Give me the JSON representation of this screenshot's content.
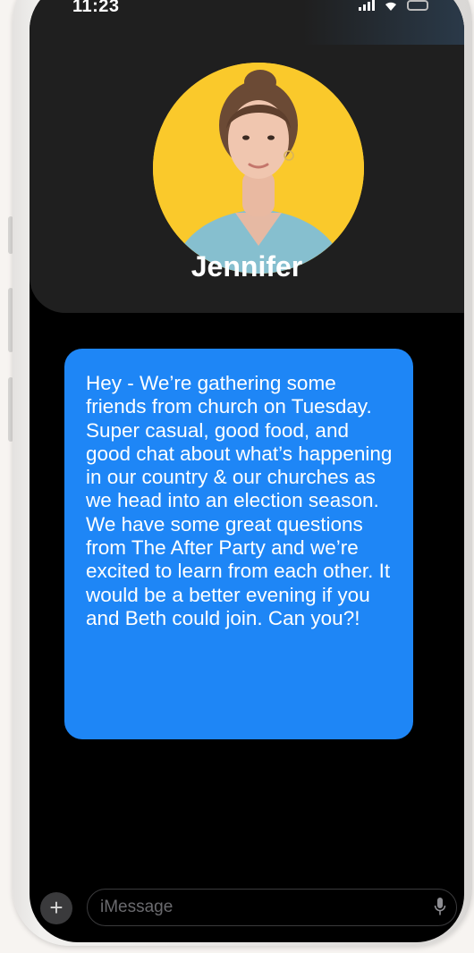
{
  "status_bar": {
    "time": "11:23"
  },
  "contact": {
    "name": "Jennifer",
    "avatar_bg": "#fac92b"
  },
  "message": {
    "text": "Hey - We’re gathering some friends from church on Tuesday. Super casual, good food, and good chat about what’s happening in our country & our churches as we head into an election season. We have some great questions from The After Party and we’re excited to learn from each other. It would be a better evening if you and Beth could join. Can you?!",
    "bubble_color": "#1e86f6"
  },
  "compose": {
    "add_icon": "plus-icon",
    "add_label": "+",
    "placeholder": "iMessage",
    "mic_icon": "mic-icon"
  },
  "icons": [
    "signal-icon",
    "wifi-icon",
    "battery-icon"
  ]
}
